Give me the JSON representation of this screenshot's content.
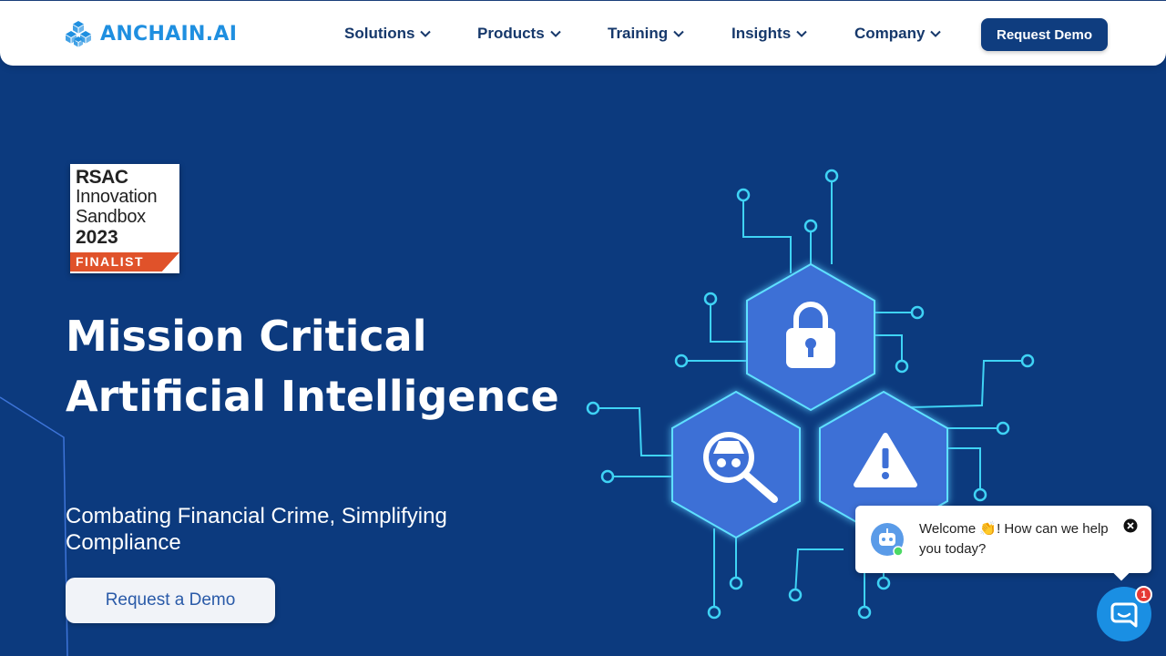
{
  "header": {
    "logo_text": "ANCHAIN.AI",
    "logo_icon": "cube-cluster-icon",
    "nav": [
      {
        "label": "Solutions"
      },
      {
        "label": "Products"
      },
      {
        "label": "Training"
      },
      {
        "label": "Insights"
      },
      {
        "label": "Company"
      }
    ],
    "cta_label": "Request Demo"
  },
  "hero": {
    "badge": {
      "line1": "RSAC",
      "line2": "Innovation",
      "line3": "Sandbox",
      "line4": "2023",
      "ribbon": "FINALIST"
    },
    "headline": "Mission Critical Artificial Intelligence",
    "subheadline": "Combating Financial Crime, Simplifying Compliance",
    "cta_label": "Request a Demo",
    "illustration_icons": [
      "lock-icon",
      "spy-magnifier-icon",
      "warning-icon"
    ]
  },
  "chat": {
    "message": "Welcome 👏! How can we help you today?",
    "unread_count": "1"
  },
  "colors": {
    "hero_background": "#0c3a7e",
    "brand_blue": "#1f8fe0",
    "nav_text": "#16386b",
    "cta_background": "#0f3d7f",
    "hex_fill": "#3d6fd6",
    "circuit": "#3fd3f5",
    "chat_launcher": "#1a8fe3"
  }
}
